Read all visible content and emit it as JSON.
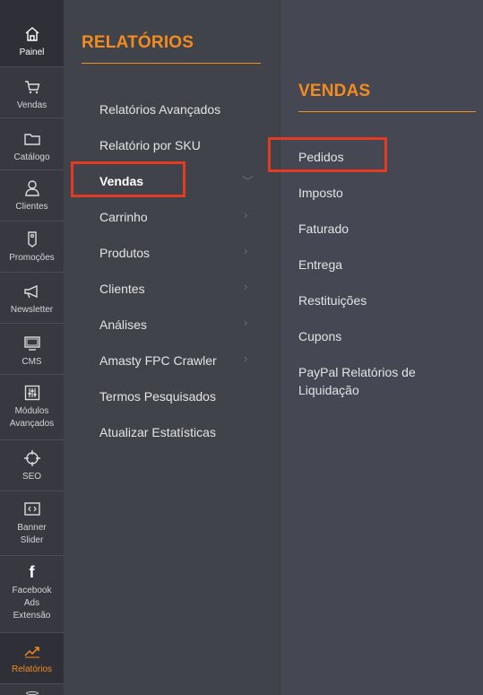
{
  "rail": [
    {
      "label": "Painel",
      "icon": "home-icon"
    },
    {
      "label": "Vendas",
      "icon": "cart-icon"
    },
    {
      "label": "Catálogo",
      "icon": "folder-icon"
    },
    {
      "label": "Clientes",
      "icon": "user-icon"
    },
    {
      "label": "Promoções",
      "icon": "tag-icon"
    },
    {
      "label": "Newsletter",
      "icon": "megaphone-icon"
    },
    {
      "label": "CMS",
      "icon": "monitor-icon"
    },
    {
      "label": "Módulos Avançados",
      "label_lines": [
        "Módulos",
        "Avançados"
      ],
      "icon": "sliders-icon"
    },
    {
      "label": "SEO",
      "icon": "crosshair-icon"
    },
    {
      "label": "Banner Slider",
      "label_lines": [
        "Banner",
        "Slider"
      ],
      "icon": "code-box-icon"
    },
    {
      "label": "Facebook Ads Extensão",
      "label_lines": [
        "Facebook",
        "Ads",
        "Extensão"
      ],
      "icon": "facebook-icon"
    },
    {
      "label": "Relatórios",
      "icon": "trend-icon"
    }
  ],
  "reports": {
    "title": "RELATÓRIOS",
    "items": [
      {
        "label": "Relatórios Avançados"
      },
      {
        "label": "Relatório por SKU"
      },
      {
        "label": "Vendas"
      },
      {
        "label": "Carrinho"
      },
      {
        "label": "Produtos"
      },
      {
        "label": "Clientes"
      },
      {
        "label": "Análises"
      },
      {
        "label": "Amasty FPC Crawler"
      },
      {
        "label": "Termos Pesquisados"
      },
      {
        "label": "Atualizar Estatísticas"
      }
    ]
  },
  "sales": {
    "title": "VENDAS",
    "items": [
      {
        "label": "Pedidos"
      },
      {
        "label": "Imposto"
      },
      {
        "label": "Faturado"
      },
      {
        "label": "Entrega"
      },
      {
        "label": "Restituições"
      },
      {
        "label": "Cupons"
      },
      {
        "label": "PayPal Relatórios de Liquidação",
        "label_lines": [
          "PayPal Relatórios de",
          "Liquidação"
        ]
      }
    ]
  },
  "colors": {
    "accent": "#f38b1f",
    "highlight": "#e43a22",
    "rail_bg": "#373840",
    "panel_bg": "#41434b"
  }
}
